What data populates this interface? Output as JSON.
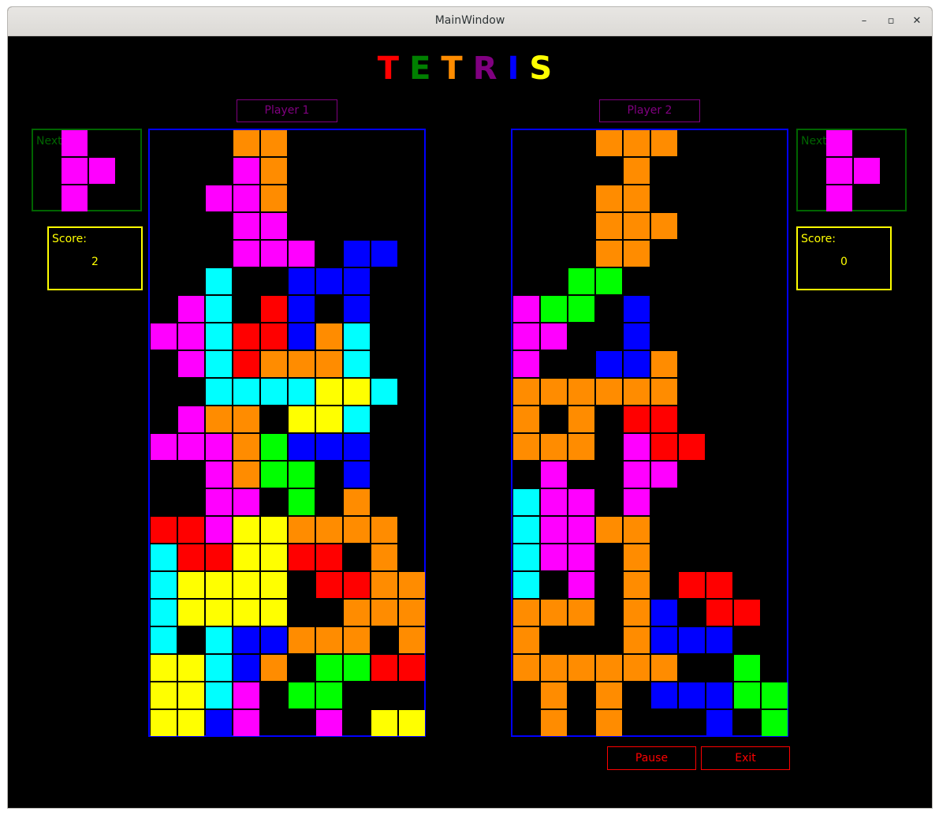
{
  "window": {
    "title": "MainWindow",
    "minimize": "–",
    "maximize": "▫",
    "close": "✕"
  },
  "logo": {
    "letters": [
      {
        "char": "T",
        "color": "#ff0000"
      },
      {
        "char": "E",
        "color": "#008000"
      },
      {
        "char": "T",
        "color": "#ff8c00"
      },
      {
        "char": "R",
        "color": "#800080"
      },
      {
        "char": "I",
        "color": "#0000ff"
      },
      {
        "char": "S",
        "color": "#ffff00"
      }
    ]
  },
  "colors": {
    "O": "#ff8c00",
    "M": "#ff00ff",
    "C": "#00ffff",
    "R": "#ff0000",
    "B": "#0000ff",
    "Y": "#ffff00",
    "G": "#00ff00"
  },
  "players": [
    {
      "label": "Player 1",
      "next_label": "Next",
      "score_label": "Score:",
      "score": "2",
      "next_piece": [
        ".M.",
        ".MM",
        ".M."
      ],
      "board": [
        "...OO.....",
        "...MO.....",
        "..MMO.....",
        "...MM.....",
        "...MMM.BB.",
        "..C..BBB..",
        ".MC.RB.B..",
        "MMCRRBOC..",
        ".MCROOOC..",
        "..CCCCYYC.",
        ".MOO.YYC..",
        "MMMOGBBB..",
        "..MOGG.B..",
        "..MM.G.O..",
        "RRMYYOOOO.",
        "CRRYYRR.O.",
        "CYYYY.RROO",
        "CYYYY..OOO",
        "C.CBBOOO.O",
        "YYCBO.GGRR",
        "YYCM.GG...",
        "YYBM..M.YY"
      ]
    },
    {
      "label": "Player 2",
      "next_label": "Next",
      "score_label": "Score:",
      "score": "0",
      "next_piece": [
        ".M.",
        ".MM",
        ".M."
      ],
      "board": [
        "...OOO....",
        "....O.....",
        "...OO.....",
        "...OOO....",
        "...OO.....",
        "..GG......",
        "MGG.B.....",
        "MM..B.....",
        "M..BBO....",
        "OOOOOO....",
        "O.O.RR....",
        "OOO.MRR...",
        ".M..MM....",
        "CMM.M.....",
        "CMMOO.....",
        "CMM.O.....",
        "C.M.O.RR..",
        "OOO.OB.RR.",
        "O...OBBB..",
        "OOOOOO..G.",
        ".O.O.BBBGG",
        ".O.O...B.G"
      ]
    }
  ],
  "controls": {
    "pause": "Pause",
    "exit": "Exit"
  }
}
